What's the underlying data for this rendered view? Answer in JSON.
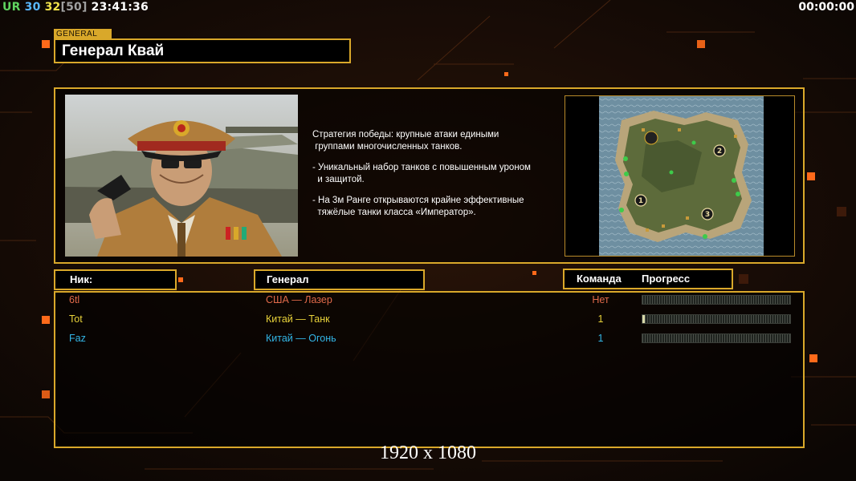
{
  "hud": {
    "ur_label": "UR",
    "value_a": "30",
    "value_b": "32",
    "bracket_value": "[50]",
    "clock": "23:41:36",
    "timer": "00:00:00",
    "colors": {
      "ur": "#5fd35f",
      "value_a": "#59b7ff",
      "value_b": "#f2e24a",
      "bracket": "#a0a0a0",
      "clock": "#ffffff"
    }
  },
  "general": {
    "category_label": "GENERAL",
    "name": "Генерал Квай",
    "description": [
      "Стратегия победы: крупные атаки едиными\n группами многочисленных танков.",
      "- Уникальный набор танков с повышенным уроном\n  и защитой.",
      "- На 3м Ранге открываются крайне эффективные\n  тяжёлые танки класса «Император»."
    ]
  },
  "map": {
    "spawn_markers": [
      "1",
      "2",
      "3"
    ]
  },
  "table": {
    "headers": {
      "nick": "Ник:",
      "general": "Генерал",
      "team": "Команда",
      "progress": "Прогресс"
    },
    "rows": [
      {
        "nick": "6tl",
        "general": "США — Лазер",
        "team": "Нет",
        "progress": 0.0,
        "color": "#e06a4a"
      },
      {
        "nick": "Tot",
        "general": "Китай — Танк",
        "team": "1",
        "progress": 0.015,
        "color": "#e8d23a"
      },
      {
        "nick": "Faz",
        "general": "Китай — Огонь",
        "team": "1",
        "progress": 0.0,
        "color": "#33b6e6"
      }
    ]
  },
  "resolution_label": "1920 x 1080",
  "theme": {
    "accent": "#d9a82a",
    "background": "#120b07",
    "glow": "#ff6a1a"
  }
}
